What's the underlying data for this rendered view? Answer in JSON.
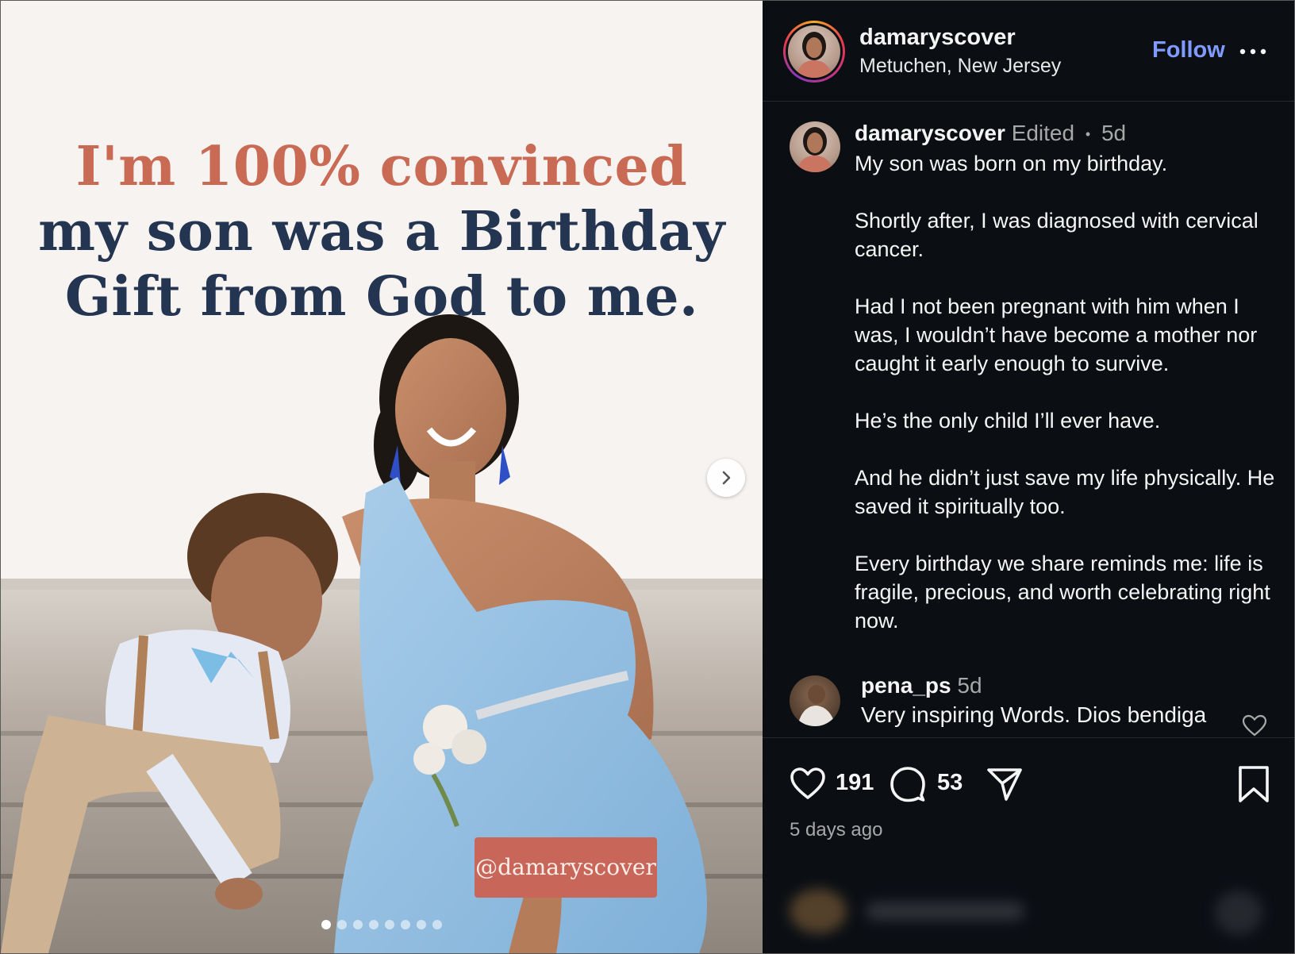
{
  "post": {
    "headline": {
      "line1": "I'm 100% convinced",
      "line2": "my son was a Birthday",
      "line3": "Gift from God to me."
    },
    "watermark": "@damaryscover",
    "carousel": {
      "total_slides": 8,
      "current_slide": 1
    },
    "colors": {
      "headline_accent": "#c96a54",
      "headline_dark": "#243552",
      "watermark_bg": "#c9665a"
    }
  },
  "header": {
    "username": "damaryscover",
    "location": "Metuchen, New Jersey",
    "follow_label": "Follow",
    "more_icon": "more-horizontal-icon"
  },
  "caption": {
    "username": "damaryscover",
    "edited_label": "Edited",
    "separator": "•",
    "time": "5d",
    "paragraphs": [
      "My son was born on my birthday.",
      "Shortly after, I was diagnosed with cervical cancer.",
      "Had I not been pregnant with him when I was, I wouldn’t have become a mother nor caught it early enough to survive.",
      "He’s the only child I’ll ever have.",
      "And he didn’t just save my life physically. He saved it spiritually too.",
      "Every birthday we share reminds me: life is fragile, precious, and worth celebrating right now."
    ]
  },
  "comments": [
    {
      "username": "pena_ps",
      "time": "5d",
      "text": "Very inspiring Words. Dios bendiga"
    }
  ],
  "actions": {
    "like_count": "191",
    "comment_count": "53",
    "posted_ago": "5 days ago",
    "icons": [
      "heart-icon",
      "comment-icon",
      "share-icon",
      "bookmark-icon"
    ]
  },
  "theme": {
    "panel_bg": "#0b0f14",
    "follow_color": "#7f9bff",
    "secondary_text": "#a8a8a8"
  }
}
